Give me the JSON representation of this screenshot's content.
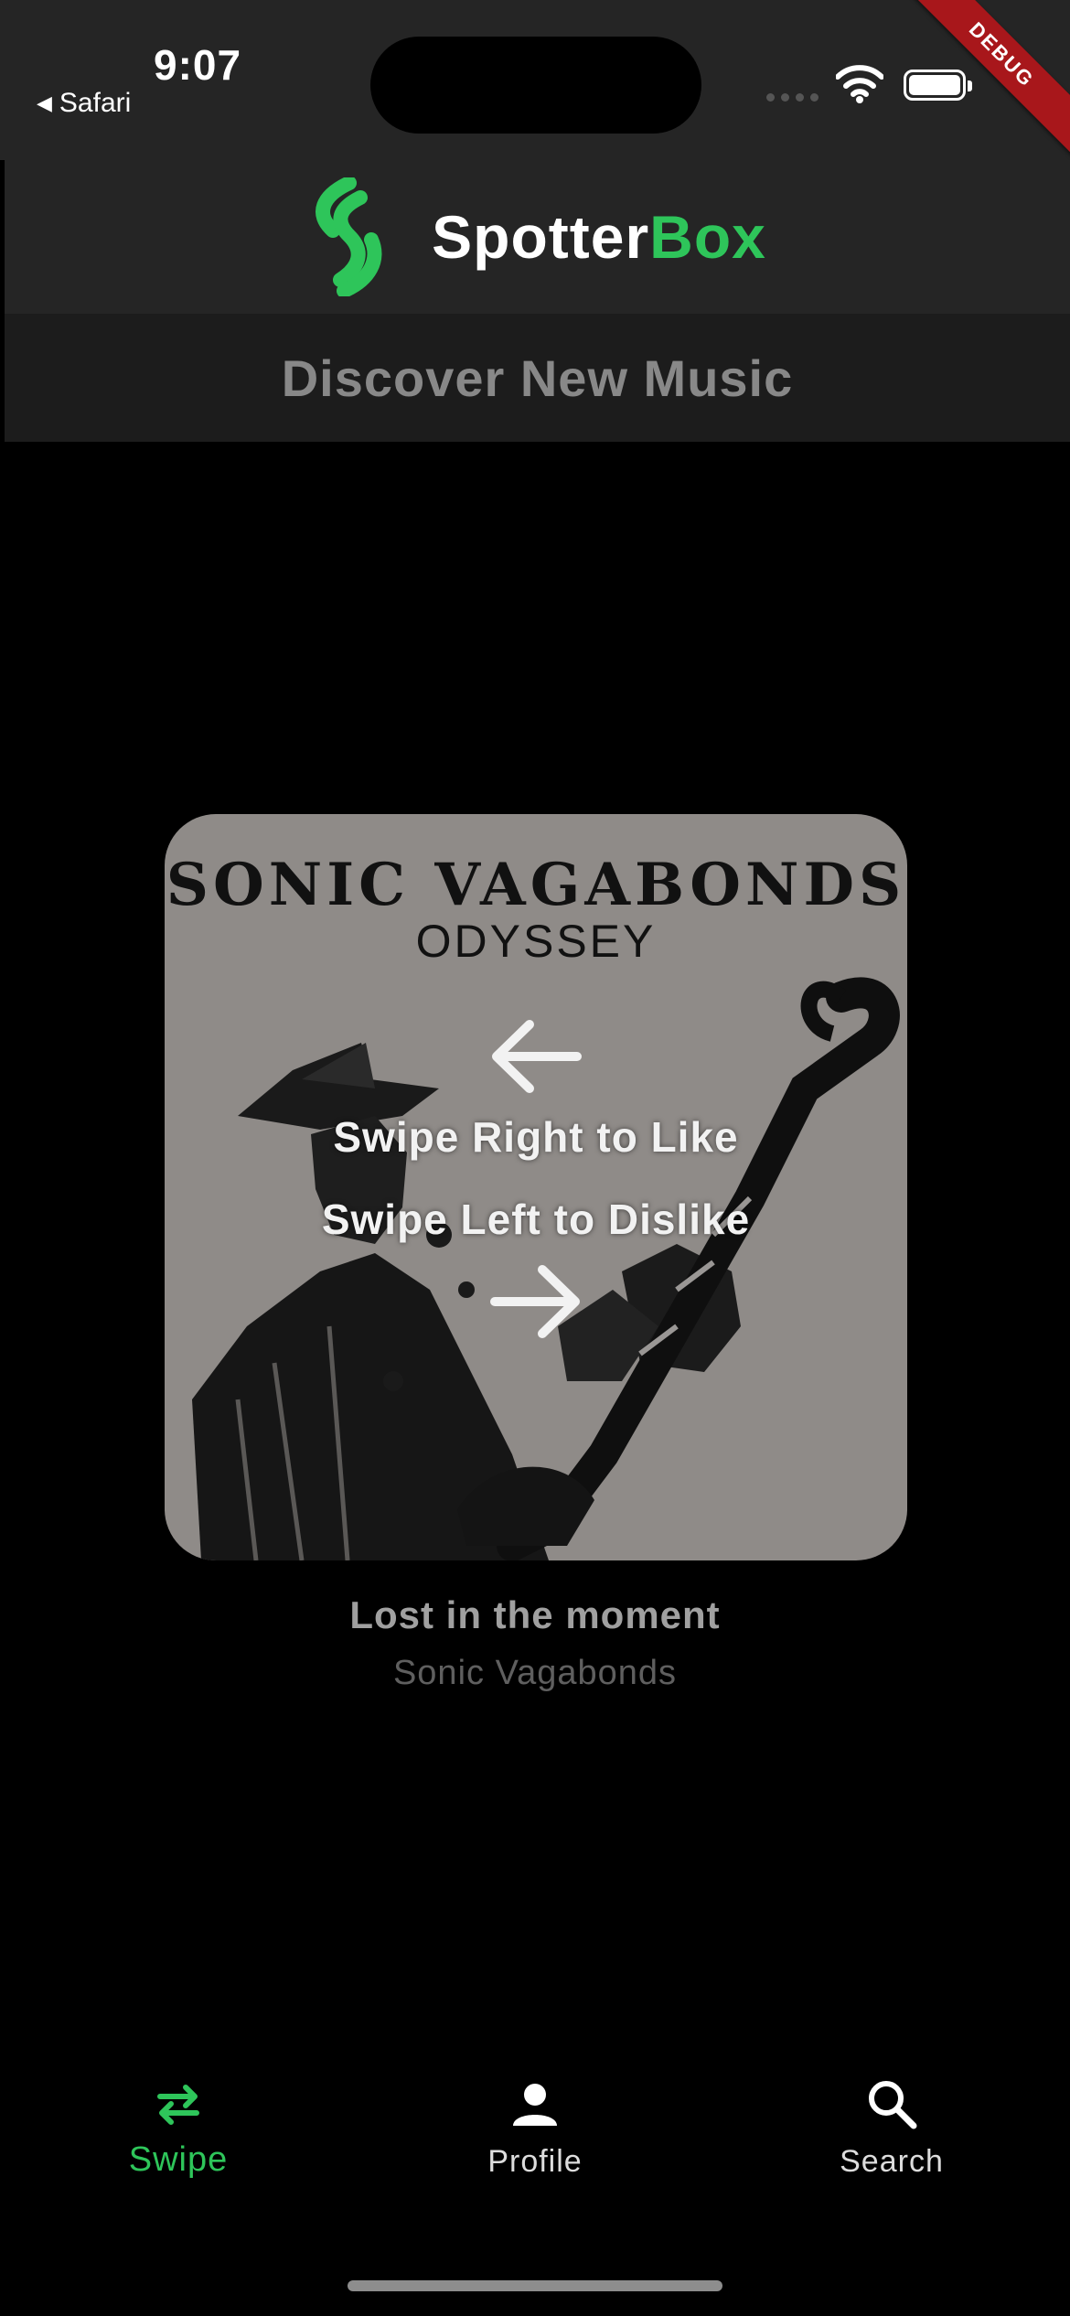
{
  "status_bar": {
    "time": "9:07",
    "back_app": "Safari",
    "debug_label": "DEBUG"
  },
  "app_bar": {
    "brand_primary": "Spotter",
    "brand_accent": "Box",
    "accent_color": "#2ec55a"
  },
  "subheader": {
    "title": "Discover New Music"
  },
  "card": {
    "album_title": "SONIC VAGABONDS",
    "album_subtitle": "ODYSSEY",
    "hint_like": "Swipe Right to Like",
    "hint_dislike": "Swipe Left to Dislike",
    "left_arrow_icon": "arrow-left-icon",
    "right_arrow_icon": "arrow-right-icon"
  },
  "track": {
    "title": "Lost in the moment",
    "artist": "Sonic Vagabonds"
  },
  "bottom_nav": {
    "items": [
      {
        "label": "Swipe",
        "icon": "swap-arrows-icon",
        "active": true
      },
      {
        "label": "Profile",
        "icon": "person-icon",
        "active": false
      },
      {
        "label": "Search",
        "icon": "search-icon",
        "active": false
      }
    ]
  }
}
